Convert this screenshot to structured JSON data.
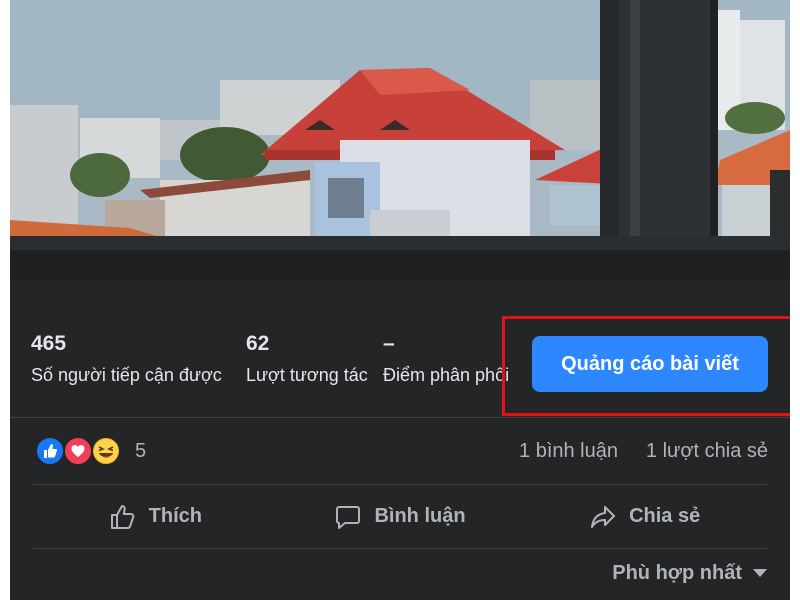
{
  "post": {
    "photo_icon": "rooftops-through-window-photo"
  },
  "insights": {
    "metrics": [
      {
        "value": "465",
        "label": "Số người tiếp cận được"
      },
      {
        "value": "62",
        "label": "Lượt tương tác"
      },
      {
        "value": "–",
        "label": "Điểm phân phối"
      }
    ],
    "boost_label": "Quảng cáo bài viết",
    "boost_color": "#2d88ff",
    "highlight_color": "#e0121b"
  },
  "reactions": {
    "icons": [
      "like-icon",
      "love-icon",
      "haha-icon"
    ],
    "count": "5",
    "comments": "1 bình luận",
    "shares": "1 lượt chia sẻ"
  },
  "actions": {
    "like_label": "Thích",
    "comment_label": "Bình luận",
    "share_label": "Chia sẻ"
  },
  "sort": {
    "label": "Phù hợp nhất"
  }
}
